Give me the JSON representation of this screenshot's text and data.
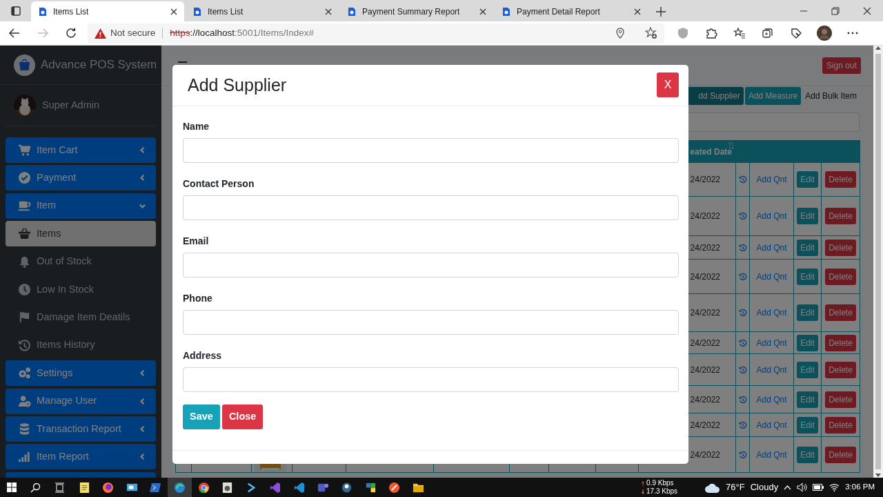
{
  "browser": {
    "tabs": [
      {
        "title": "Items List",
        "selected": true
      },
      {
        "title": "Items List",
        "selected": false
      },
      {
        "title": "Payment Summary Report",
        "selected": false
      },
      {
        "title": "Payment Detail Report",
        "selected": false
      }
    ],
    "forward_disabled": true,
    "security": "Not secure",
    "url": {
      "scheme": "https",
      "host": "://localhost",
      "path": ":5001/Items/Index#"
    }
  },
  "sidebar": {
    "brand": "Advance POS System",
    "user": "Super Admin",
    "menu": [
      {
        "label": "Item Cart",
        "kind": "cart",
        "expanded": false
      },
      {
        "label": "Payment",
        "kind": "check",
        "expanded": false
      },
      {
        "label": "Item",
        "kind": "cup",
        "expanded": true,
        "children": [
          {
            "label": "Items",
            "kind": "basket",
            "selected": true
          },
          {
            "label": "Out of Stock",
            "kind": "bell",
            "selected": false
          },
          {
            "label": "Low In Stock",
            "kind": "clock",
            "selected": false
          },
          {
            "label": "Damage Item Deatils",
            "kind": "flag",
            "selected": false
          },
          {
            "label": "Items History",
            "kind": "history",
            "selected": false
          }
        ]
      },
      {
        "label": "Settings",
        "kind": "gears",
        "expanded": false
      },
      {
        "label": "Manage User",
        "kind": "userclock",
        "expanded": false
      },
      {
        "label": "Transaction Report",
        "kind": "database",
        "expanded": false
      },
      {
        "label": "Item Report",
        "kind": "bars",
        "expanded": false
      }
    ]
  },
  "header": {
    "sign_out": "Sign out"
  },
  "toolbar": [
    {
      "label": "dd Supplier",
      "kind": "filled",
      "pressed": true
    },
    {
      "label": "Add Measure",
      "kind": "filled",
      "pressed": false
    },
    {
      "label": "Add Bulk Item",
      "kind": "plain",
      "pressed": false
    }
  ],
  "table": {
    "date_header": "eated Date",
    "rows": [
      {
        "date": "24/2022",
        "action": "Add Qnt",
        "edit": "Edit",
        "delete": "Delete"
      },
      {
        "date": "24/2022",
        "action": "Add Qnt",
        "edit": "Edit",
        "delete": "Delete"
      },
      {
        "date": "24/2022",
        "action": "Add Qnt",
        "edit": "Edit",
        "delete": "Delete"
      },
      {
        "date": "24/2022",
        "action": "Add Qnt",
        "edit": "Edit",
        "delete": "Delete"
      },
      {
        "date": "24/2022",
        "action": "Add Qnt",
        "edit": "Edit",
        "delete": "Delete"
      },
      {
        "date": "24/2022",
        "action": "Add Qnt",
        "edit": "Edit",
        "delete": "Delete"
      },
      {
        "date": "24/2022",
        "action": "Add Qnt",
        "edit": "Edit",
        "delete": "Delete"
      },
      {
        "date": "24/2022",
        "action": "Add Qnt",
        "edit": "Edit",
        "delete": "Delete"
      },
      {
        "date": "24/2022",
        "action": "Add Qnt",
        "edit": "Edit",
        "delete": "Delete"
      },
      {
        "date": "24/2022",
        "action": "Add Qnt",
        "edit": "Edit",
        "delete": "Delete",
        "thumbnail": true
      }
    ]
  },
  "modal": {
    "title": "Add Supplier",
    "close": "X",
    "fields": [
      {
        "label": "Name"
      },
      {
        "label": "Contact Person"
      },
      {
        "label": "Email"
      },
      {
        "label": "Phone"
      },
      {
        "label": "Address"
      }
    ],
    "buttons": [
      {
        "label": "Save",
        "kind": "save"
      },
      {
        "label": "Close",
        "kind": "close"
      }
    ]
  },
  "taskbar": {
    "apps": [
      {
        "kind": "notes",
        "selected": false
      },
      {
        "kind": "fox",
        "selected": false
      },
      {
        "kind": "remote",
        "selected": false
      },
      {
        "kind": "shell",
        "selected": false
      },
      {
        "kind": "edge",
        "selected": true
      },
      {
        "kind": "chrome",
        "selected": false
      },
      {
        "kind": "gimp",
        "selected": false
      },
      {
        "kind": "terminal",
        "selected": false
      },
      {
        "kind": "vs",
        "selected": false
      },
      {
        "kind": "vscode",
        "selected": false
      },
      {
        "kind": "teams",
        "selected": false
      },
      {
        "kind": "elephant",
        "selected": false
      },
      {
        "kind": "python",
        "selected": false
      },
      {
        "kind": "brave",
        "selected": false
      },
      {
        "kind": "folder",
        "selected": false
      }
    ],
    "upload": "0.9 Kbps",
    "download": "17.3 Kbps",
    "temperature": "76°F",
    "weather": "Cloudy",
    "time": "3:06 PM"
  }
}
